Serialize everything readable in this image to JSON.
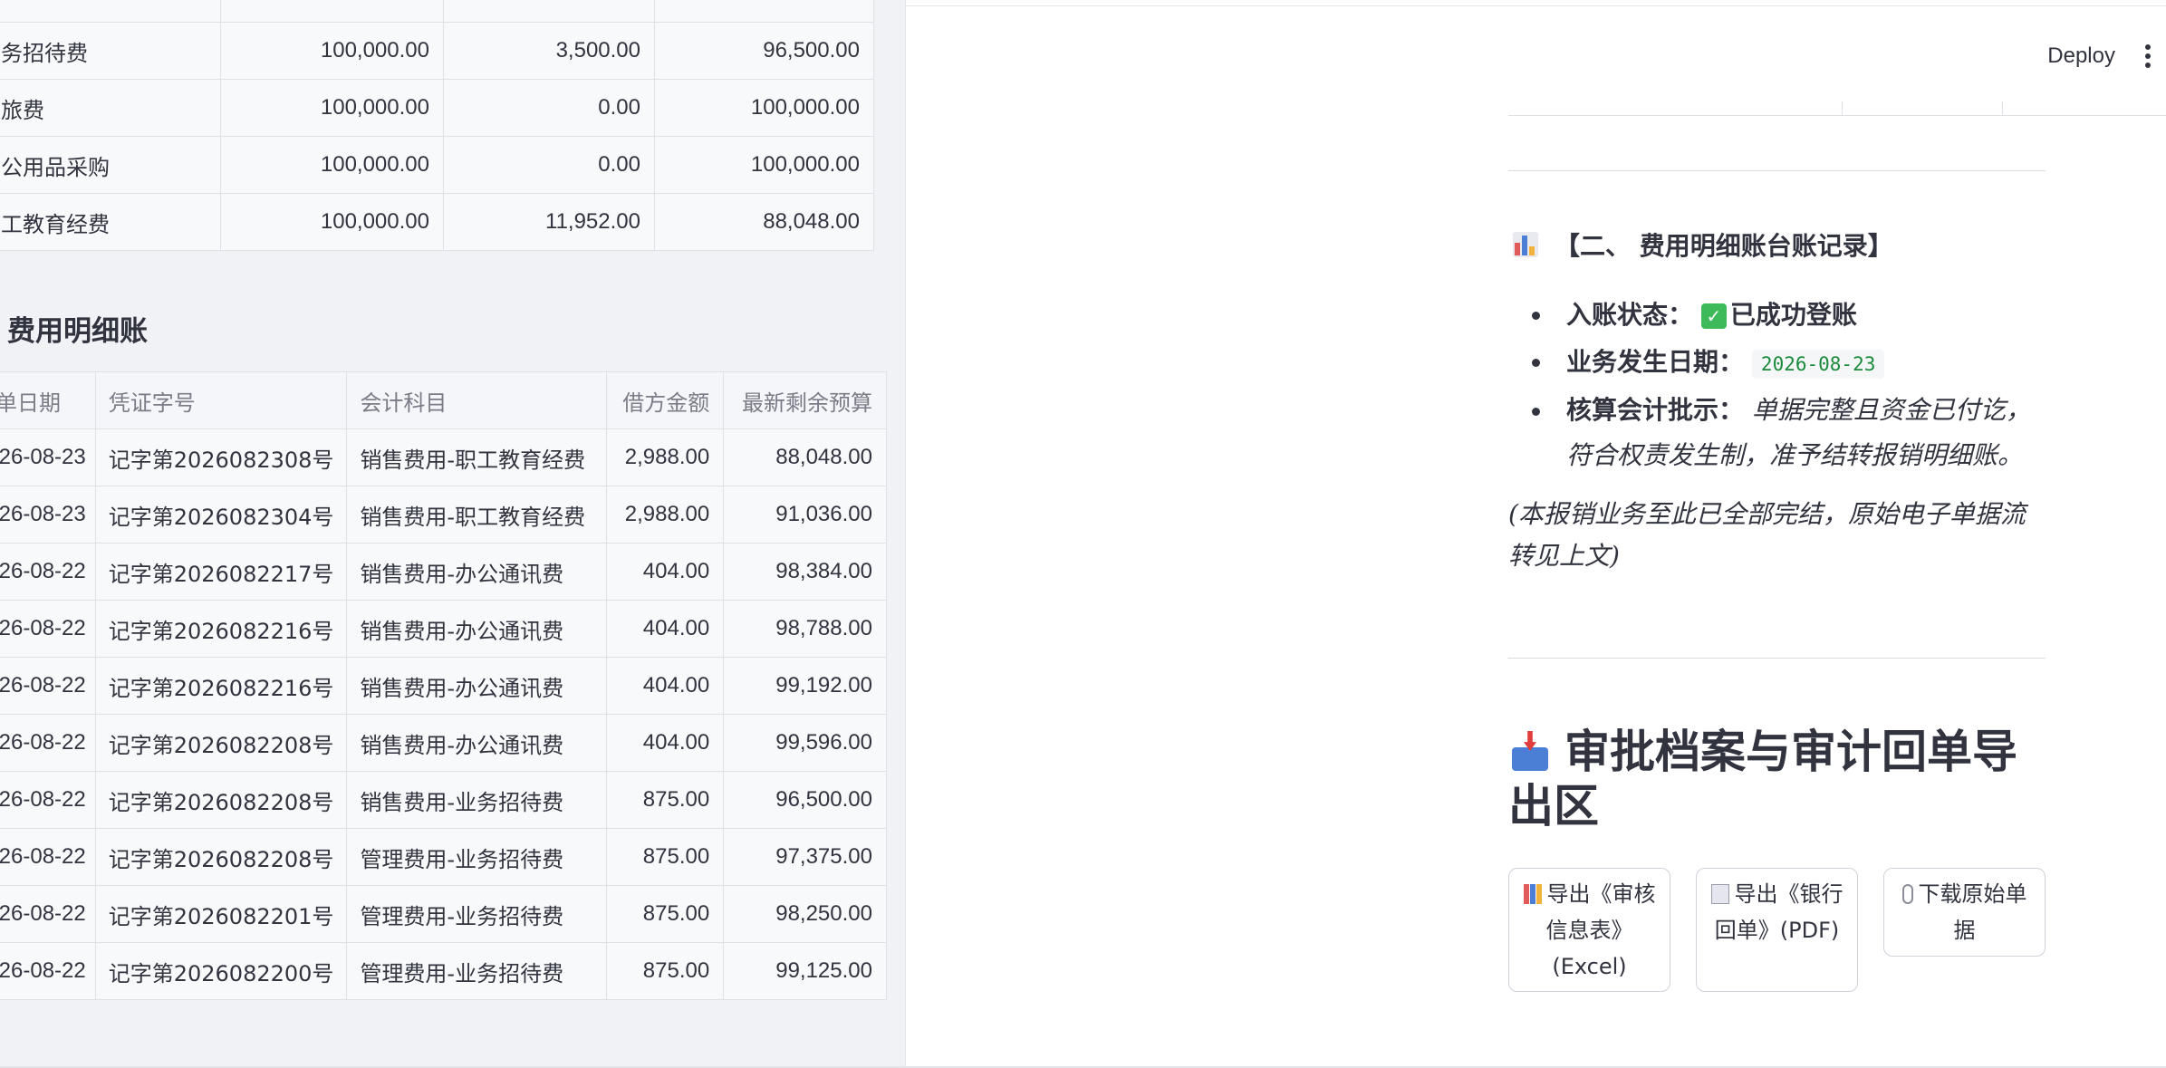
{
  "header": {
    "deploy_label": "Deploy"
  },
  "budget_table": {
    "rows": [
      {
        "name": "务招待费",
        "budget": "100,000.00",
        "used": "3,500.00",
        "remaining": "96,500.00"
      },
      {
        "name": "旅费",
        "budget": "100,000.00",
        "used": "0.00",
        "remaining": "100,000.00"
      },
      {
        "name": "公用品采购",
        "budget": "100,000.00",
        "used": "0.00",
        "remaining": "100,000.00"
      },
      {
        "name": "工教育经费",
        "budget": "100,000.00",
        "used": "11,952.00",
        "remaining": "88,048.00"
      }
    ]
  },
  "ledger": {
    "title": "费用明细账",
    "columns": [
      "单日期",
      "凭证字号",
      "会计科目",
      "借方金额",
      "最新剩余预算"
    ],
    "rows": [
      {
        "date": "26-08-23",
        "voucher": "记字第2026082308号",
        "account": "销售费用-职工教育经费",
        "debit": "2,988.00",
        "remaining": "88,048.00"
      },
      {
        "date": "26-08-23",
        "voucher": "记字第2026082304号",
        "account": "销售费用-职工教育经费",
        "debit": "2,988.00",
        "remaining": "91,036.00"
      },
      {
        "date": "26-08-22",
        "voucher": "记字第2026082217号",
        "account": "销售费用-办公通讯费",
        "debit": "404.00",
        "remaining": "98,384.00"
      },
      {
        "date": "26-08-22",
        "voucher": "记字第2026082216号",
        "account": "销售费用-办公通讯费",
        "debit": "404.00",
        "remaining": "98,788.00"
      },
      {
        "date": "26-08-22",
        "voucher": "记字第2026082216号",
        "account": "销售费用-办公通讯费",
        "debit": "404.00",
        "remaining": "99,192.00"
      },
      {
        "date": "26-08-22",
        "voucher": "记字第2026082208号",
        "account": "销售费用-办公通讯费",
        "debit": "404.00",
        "remaining": "99,596.00"
      },
      {
        "date": "26-08-22",
        "voucher": "记字第2026082208号",
        "account": "销售费用-业务招待费",
        "debit": "875.00",
        "remaining": "96,500.00"
      },
      {
        "date": "26-08-22",
        "voucher": "记字第2026082208号",
        "account": "管理费用-业务招待费",
        "debit": "875.00",
        "remaining": "97,375.00"
      },
      {
        "date": "26-08-22",
        "voucher": "记字第2026082201号",
        "account": "管理费用-业务招待费",
        "debit": "875.00",
        "remaining": "98,250.00"
      },
      {
        "date": "26-08-22",
        "voucher": "记字第2026082200号",
        "account": "管理费用-业务招待费",
        "debit": "875.00",
        "remaining": "99,125.00"
      }
    ]
  },
  "section2": {
    "title": "【二、 费用明细账台账记录】",
    "status_label": "入账状态：",
    "status_value": "已成功登账",
    "date_label": "业务发生日期：",
    "date_value": "2026-08-23",
    "comment_label": "核算会计批示：",
    "comment_value": "单据完整且资金已付讫，符合权责发生制，准予结转报销明细账。",
    "note": "(本报销业务至此已全部完结，原始电子单据流转见上文)"
  },
  "export_section": {
    "title": "审批档案与审计回单导出区",
    "buttons": [
      {
        "label": "导出《审核信息表》(Excel)",
        "icon": "bar-chart-icon"
      },
      {
        "label": "导出《银行回单》(PDF)",
        "icon": "receipt-icon"
      },
      {
        "label": "下载原始单据",
        "icon": "paperclip-icon"
      }
    ]
  },
  "colors": {
    "sidebar_bg": "#f0f2f6",
    "text": "#31333f",
    "code_green": "#1b8a3a",
    "check_green": "#3fba5a"
  }
}
